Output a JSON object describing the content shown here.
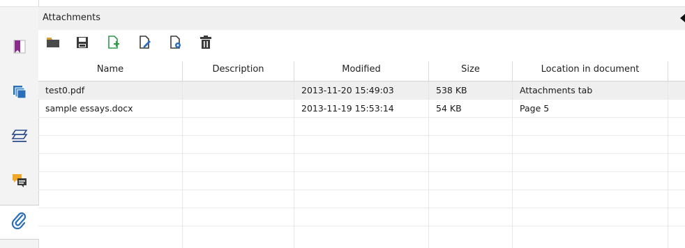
{
  "panel": {
    "title": "Attachments"
  },
  "toolbar": {
    "buttons": [
      {
        "icon": "open-folder-icon",
        "color": "#4a4a4a"
      },
      {
        "icon": "save-icon",
        "color": "#3a3a3a"
      },
      {
        "icon": "add-file-icon",
        "color": "#2e9a4a"
      },
      {
        "icon": "edit-file-icon",
        "color": "#3a3a3a"
      },
      {
        "icon": "file-settings-icon",
        "color": "#3a3a3a"
      },
      {
        "icon": "delete-icon",
        "color": "#3a3a3a"
      }
    ]
  },
  "sidebar": {
    "items": [
      {
        "icon": "bookmark-icon",
        "color": "#8a2a8c"
      },
      {
        "icon": "pages-icon",
        "color": "#2a6fb8"
      },
      {
        "icon": "layers-icon",
        "color": "#2a4a8c"
      },
      {
        "icon": "comments-icon",
        "color": "#e8a020"
      },
      {
        "icon": "attachment-icon",
        "color": "#2a6fb8",
        "active": true
      }
    ]
  },
  "table": {
    "columns": [
      "Name",
      "Description",
      "Modified",
      "Size",
      "Location in document"
    ],
    "rows": [
      {
        "name": "test0.pdf",
        "description": "",
        "modified": "2013-11-20 15:49:03",
        "size": "538 KB",
        "location": "Attachments tab",
        "selected": true
      },
      {
        "name": "sample essays.docx",
        "description": "",
        "modified": "2013-11-19 15:53:14",
        "size": "54 KB",
        "location": "Page 5",
        "selected": false
      }
    ]
  }
}
